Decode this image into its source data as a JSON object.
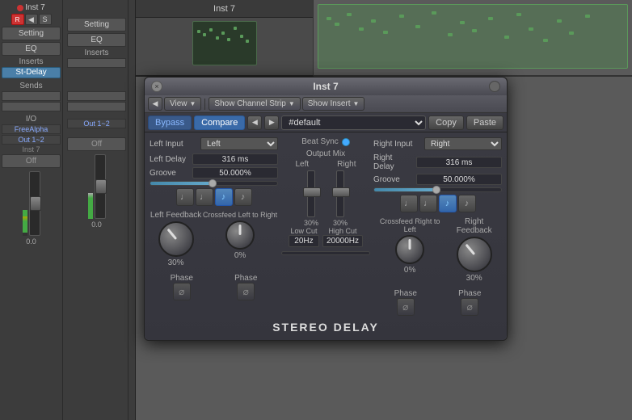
{
  "window": {
    "title": "Inst 7"
  },
  "plugin": {
    "title": "Inst 7",
    "footer_label": "Stereo Delay",
    "close_btn": "×",
    "toolbar": {
      "view_label": "View",
      "channel_strip_label": "Show Channel Strip",
      "insert_label": "Show Insert"
    },
    "preset_bar": {
      "bypass_label": "Bypass",
      "compare_label": "Compare",
      "nav_prev": "◀",
      "nav_next": "▶",
      "preset_value": "#default",
      "copy_label": "Copy",
      "paste_label": "Paste"
    },
    "left": {
      "input_label": "Left Input",
      "input_value": "Left",
      "delay_label": "Left Delay",
      "delay_value": "316 ms",
      "groove_label": "Groove",
      "groove_value": "50.000%",
      "feedback_label": "Left Feedback",
      "feedback_value": "30%",
      "crossfeed_label": "Crossfeed Left to Right",
      "crossfeed_value": "0%",
      "phase_label": "Phase"
    },
    "center": {
      "beat_sync_label": "Beat Sync",
      "output_mix_label": "Output Mix",
      "left_label": "Left",
      "right_label": "Right",
      "left_pct": "30%",
      "right_pct": "30%",
      "low_cut_label": "Low Cut",
      "low_cut_value": "20Hz",
      "high_cut_label": "High Cut",
      "high_cut_value": "20000Hz"
    },
    "right": {
      "input_label": "Right Input",
      "input_value": "Right",
      "delay_label": "Right Delay",
      "delay_value": "316 ms",
      "groove_label": "Groove",
      "groove_value": "50.000%",
      "crossfeed_label": "Crossfeed Right to Left",
      "crossfeed_value": "0%",
      "feedback_label": "Right Feedback",
      "feedback_value": "30%",
      "phase_label": "Phase"
    },
    "note_icons": [
      "♩",
      "♩",
      "♪",
      "♪"
    ],
    "note_icons_right": [
      "♩",
      "♩",
      "♪",
      "♪"
    ]
  },
  "left_channel": {
    "setting_label": "Setting",
    "eq_label": "EQ",
    "inserts_label": "Inserts",
    "st_delay_label": "St-Delay",
    "sends_label": "Sends",
    "io_label": "I/O",
    "instrument_label": "FreeAlpha",
    "output_label": "Out 1~2",
    "track_label": "Inst 7",
    "off_label": "Off",
    "vol_value": "0.0"
  },
  "right_channel": {
    "setting_label": "Setting",
    "eq_label": "EQ",
    "inserts_label": "Inserts",
    "output_label": "Out 1~2",
    "off_label": "Off",
    "vol_value": "0.0"
  },
  "arrangement": {
    "inst_label": "Inst 7"
  }
}
